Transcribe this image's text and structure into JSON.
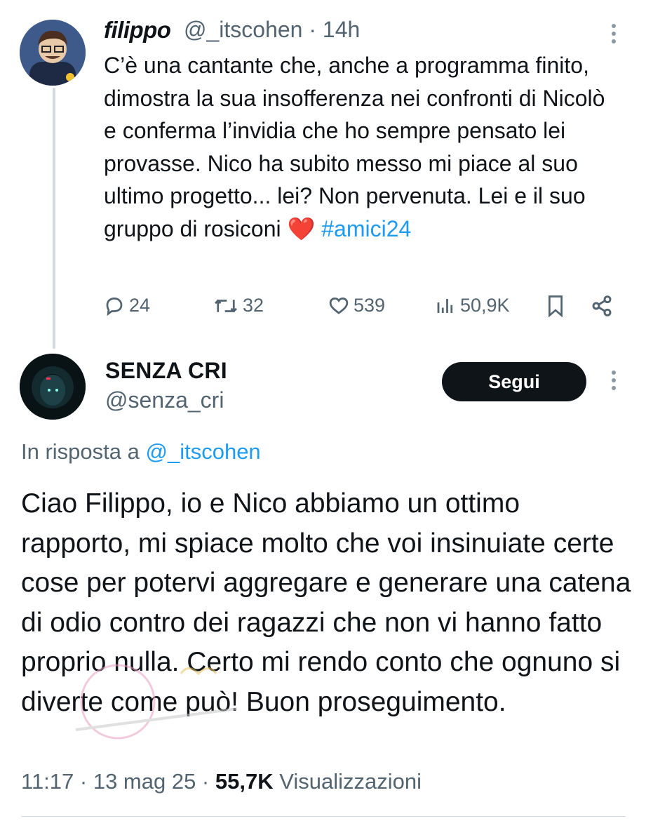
{
  "tweet1": {
    "display_name": "filippo",
    "handle_time": "@_itscohen · 14h",
    "body": "C’è una cantante che, anche a programma finito, dimostra la sua insofferenza nei confronti di Nicolò e conferma l’invidia che ho sempre pensato lei provasse. Nico ha subito messo mi piace al suo ultimo progetto... lei? Non pervenuta. Lei e il suo gruppo di rosiconi",
    "emoji": "❤️",
    "hashtag": "#amici24",
    "stats": {
      "replies": "24",
      "reposts": "32",
      "likes": "539",
      "views": "50,9K"
    }
  },
  "tweet2": {
    "display_name": "SENZA CRI",
    "handle": "@senza_cri",
    "follow_label": "Segui",
    "reply_prefix": "In risposta a",
    "reply_mention": "@_itscohen",
    "body": "Ciao Filippo, io e Nico abbiamo un ottimo rapporto, mi spiace molto che voi insinuiate certe cose per potervi aggregare e generare una catena di odio contro dei ragazzi che non vi hanno fatto proprio nulla. Certo mi rendo conto che ognuno si diverte come può! Buon proseguimento.",
    "time_date": "11:17 · 13 mag 25 ·",
    "views_count": "55,7K",
    "views_label": "Visualizzazioni"
  },
  "icons": [
    "reply-icon",
    "repost-icon",
    "like-icon",
    "views-icon",
    "bookmark-icon",
    "share-icon",
    "more-icon"
  ],
  "colors": {
    "accent": "#1d9bf0",
    "muted": "#536471",
    "text": "#0f1419",
    "button": "#0f1419"
  }
}
